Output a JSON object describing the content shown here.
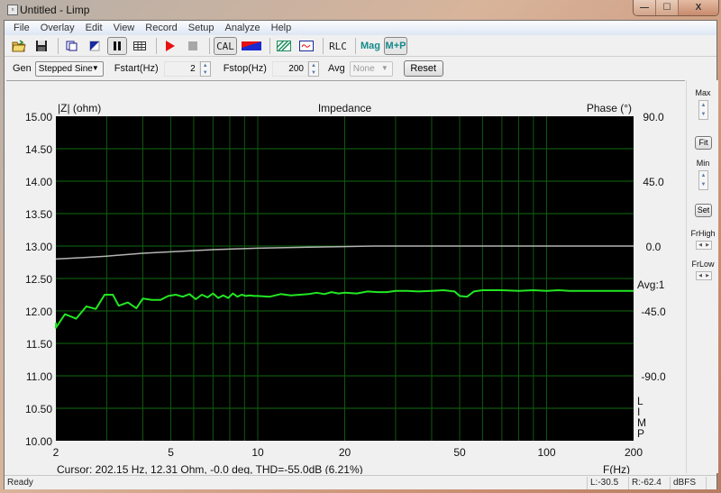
{
  "window": {
    "title": "Untitled - Limp",
    "controls": {
      "minimize": "—",
      "maximize": "☐",
      "close": "X"
    }
  },
  "menu": [
    "File",
    "Overlay",
    "Edit",
    "View",
    "Record",
    "Setup",
    "Analyze",
    "Help"
  ],
  "toolbar": {
    "icons": [
      "open-folder-icon",
      "save-disk-icon",
      "copy-icon",
      "mark-icon",
      "pause-icon",
      "table-icon",
      "play-icon",
      "stop-icon"
    ],
    "cal_label": "CAL",
    "rlc_label": "RLC",
    "mag_label": "Mag",
    "mp_label": "M+P"
  },
  "genbar": {
    "gen_label": "Gen",
    "gen_value": "Stepped Sine",
    "fstart_label": "Fstart(Hz)",
    "fstart_value": "2",
    "fstop_label": "Fstop(Hz)",
    "fstop_value": "200",
    "avg_label": "Avg",
    "avg_value": "None",
    "reset_label": "Reset"
  },
  "right_panel": {
    "max_label": "Max",
    "fit_label": "Fit",
    "min_label": "Min",
    "set_label": "Set",
    "frhigh_label": "FrHigh",
    "frlow_label": "FrLow"
  },
  "status": {
    "ready": "Ready",
    "left_level": "L:-30.5",
    "right_level": "R:-62.4",
    "units": "dBFS"
  },
  "chart_data": {
    "type": "line",
    "title": "Impedance",
    "ylabel": "|Z| (ohm)",
    "y2label": "Phase (°)",
    "xlabel": "F(Hz)",
    "xscale": "log",
    "xlim": [
      2,
      200
    ],
    "ylim": [
      10.0,
      15.0
    ],
    "y2lim": [
      -135,
      90
    ],
    "x_ticks": [
      2,
      5,
      10,
      20,
      50,
      100,
      200
    ],
    "x_tick_labels": [
      "2",
      "5",
      "10",
      "20",
      "50",
      "100",
      "200"
    ],
    "x_minor_ticks": [
      3,
      4,
      6,
      7,
      8,
      9,
      30,
      40,
      60,
      70,
      80,
      90
    ],
    "y_ticks": [
      10.0,
      10.5,
      11.0,
      11.5,
      12.0,
      12.5,
      13.0,
      13.5,
      14.0,
      14.5,
      15.0
    ],
    "y_tick_labels": [
      "10.00",
      "10.50",
      "11.00",
      "11.50",
      "12.00",
      "12.50",
      "13.00",
      "13.50",
      "14.00",
      "14.50",
      "15.00"
    ],
    "y2_ticks": [
      90,
      45,
      0,
      -45,
      -90
    ],
    "y2_tick_labels": [
      "90.0",
      "45.0",
      "0.0",
      "-45.0",
      "-90.0"
    ],
    "grid": true,
    "avg_label": "Avg:1",
    "watermark": [
      "L",
      "I",
      "M",
      "P"
    ],
    "cursor_text": "Cursor: 202.15 Hz, 12.31 Ohm, -0.0 deg, THD=-55.0dB (6.21%)",
    "series": [
      {
        "name": "Impedance",
        "axis": "left",
        "color": "#22e622",
        "x": [
          2.0,
          2.0,
          2.15,
          2.35,
          2.55,
          2.75,
          2.95,
          3.15,
          3.3,
          3.55,
          3.8,
          4.0,
          4.3,
          4.6,
          4.9,
          5.2,
          5.5,
          5.8,
          6.1,
          6.4,
          6.7,
          7.0,
          7.3,
          7.6,
          7.9,
          8.2,
          8.5,
          8.8,
          9.1,
          9.4,
          9.7,
          10.0,
          11,
          12,
          13,
          14,
          15,
          16,
          17,
          18,
          19,
          20,
          22,
          24,
          26,
          28,
          30,
          33,
          36,
          40,
          44,
          48,
          50,
          53,
          56,
          60,
          70,
          80,
          90,
          100,
          110,
          120,
          150,
          200
        ],
        "y": [
          11.82,
          11.74,
          11.95,
          11.88,
          12.07,
          12.03,
          12.25,
          12.25,
          12.08,
          12.13,
          12.04,
          12.19,
          12.17,
          12.17,
          12.23,
          12.25,
          12.22,
          12.26,
          12.18,
          12.25,
          12.21,
          12.27,
          12.2,
          12.24,
          12.2,
          12.27,
          12.22,
          12.25,
          12.23,
          12.24,
          12.23,
          12.23,
          12.22,
          12.26,
          12.24,
          12.25,
          12.26,
          12.28,
          12.26,
          12.29,
          12.27,
          12.28,
          12.27,
          12.3,
          12.29,
          12.29,
          12.31,
          12.31,
          12.3,
          12.31,
          12.32,
          12.3,
          12.23,
          12.22,
          12.3,
          12.32,
          12.32,
          12.31,
          12.32,
          12.31,
          12.32,
          12.31,
          12.31,
          12.31
        ]
      },
      {
        "name": "Phase",
        "axis": "right",
        "color": "#b4b4b4",
        "x": [
          2.0,
          2.5,
          3.0,
          4.0,
          5.0,
          7.0,
          10.0,
          15.0,
          25.0,
          50.0,
          100.0,
          200.0
        ],
        "y": [
          -9,
          -8,
          -7,
          -5,
          -4,
          -2.5,
          -1.5,
          -0.8,
          0,
          0,
          0,
          0
        ]
      }
    ]
  }
}
